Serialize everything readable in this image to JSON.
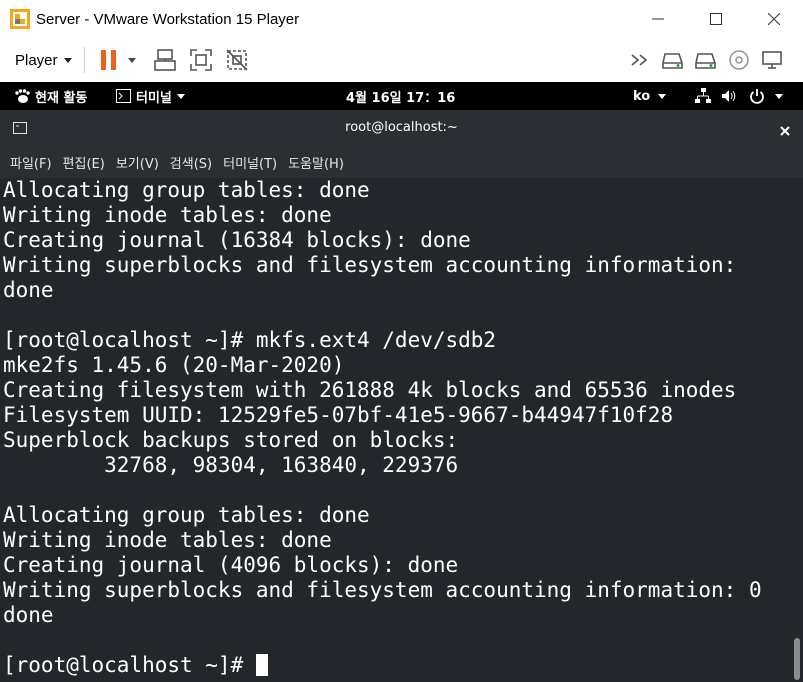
{
  "window": {
    "title": "Server - VMware Workstation 15 Player"
  },
  "toolbar": {
    "player_label": "Player"
  },
  "gnome": {
    "activities": "현재 활동",
    "app_menu": "터미널",
    "clock": "4월 16일  17：16",
    "lang": "ko"
  },
  "terminal": {
    "title": "root@localhost:~",
    "menu": [
      "파일(F)",
      "편집(E)",
      "보기(V)",
      "검색(S)",
      "터미널(T)",
      "도움말(H)"
    ],
    "lines": [
      "Allocating group tables: done",
      "Writing inode tables: done",
      "Creating journal (16384 blocks): done",
      "Writing superblocks and filesystem accounting information:",
      "done",
      "",
      "[root@localhost ~]# mkfs.ext4 /dev/sdb2",
      "mke2fs 1.45.6 (20-Mar-2020)",
      "Creating filesystem with 261888 4k blocks and 65536 inodes",
      "Filesystem UUID: 12529fe5-07bf-41e5-9667-b44947f10f28",
      "Superblock backups stored on blocks:",
      "        32768, 98304, 163840, 229376",
      "",
      "Allocating group tables: done",
      "Writing inode tables: done",
      "Creating journal (4096 blocks): done",
      "Writing superblocks and filesystem accounting information: 0",
      "done",
      ""
    ],
    "prompt": "[root@localhost ~]# "
  },
  "icons": {
    "app": "vmware-logo-icon",
    "pause": "pause-icon",
    "send_keys": "send-ctrl-alt-del-icon",
    "fullscreen": "fullscreen-icon",
    "unity": "unity-icon",
    "forward": "double-chevron-icon",
    "hdd1": "hard-disk-icon",
    "hdd2": "hard-disk-icon",
    "cd": "cd-rom-icon",
    "usb": "usb-device-icon",
    "network": "network-icon",
    "volume": "volume-icon",
    "power": "power-icon"
  },
  "colors": {
    "terminal_bg": "#23272b",
    "terminal_header": "#2b2e33",
    "pause_orange": "#e8641c"
  }
}
